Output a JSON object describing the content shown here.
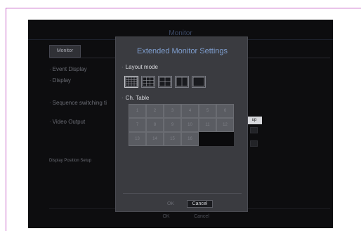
{
  "background": {
    "window_title": "Monitor",
    "tab_label": "Monitor",
    "items": [
      {
        "label": "Event Display"
      },
      {
        "label": "Display"
      },
      {
        "label": "Sequence switching ti"
      },
      {
        "label": "Video Output"
      }
    ],
    "display_position_setup": "Display Position Setup",
    "setup_label": "up",
    "ok_label": "OK",
    "cancel_label": "Cancel"
  },
  "dialog": {
    "title": "Extended Monitor Settings",
    "layout_mode_label": "Layout mode",
    "ch_table_label": "Ch. Table",
    "layout_options": [
      {
        "icon": "grid-16-icon",
        "selected": true
      },
      {
        "icon": "grid-9-icon",
        "selected": false
      },
      {
        "icon": "grid-4-icon",
        "selected": false
      },
      {
        "icon": "grid-2-icon",
        "selected": false
      },
      {
        "icon": "grid-1-icon",
        "selected": false
      }
    ],
    "channels": [
      "1",
      "2",
      "3",
      "4",
      "5",
      "6",
      "7",
      "8",
      "9",
      "10",
      "11",
      "12",
      "13",
      "14",
      "15",
      "16"
    ],
    "ok_label": "OK",
    "cancel_label": "Cancel"
  },
  "colors": {
    "dialog_title": "#7f9fd0",
    "dialog_background": "#3a3b40",
    "screen_background": "#0d0d0f",
    "frame_accent": "#c867c8"
  }
}
